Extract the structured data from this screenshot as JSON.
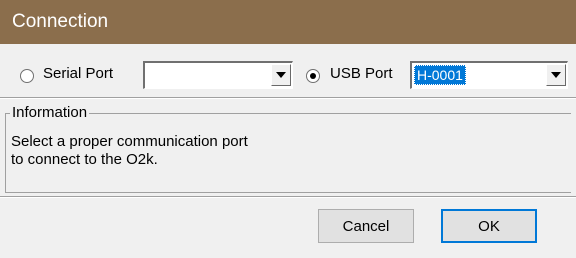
{
  "window": {
    "title": "Connection"
  },
  "connection": {
    "serial_label": "Serial Port",
    "serial_value": "",
    "usb_label": "USB Port",
    "usb_value": "H-0001"
  },
  "information": {
    "legend": "Information",
    "line1": "Select a proper communication port",
    "line2": "to connect to the O2k."
  },
  "buttons": {
    "cancel": "Cancel",
    "ok": "OK"
  }
}
